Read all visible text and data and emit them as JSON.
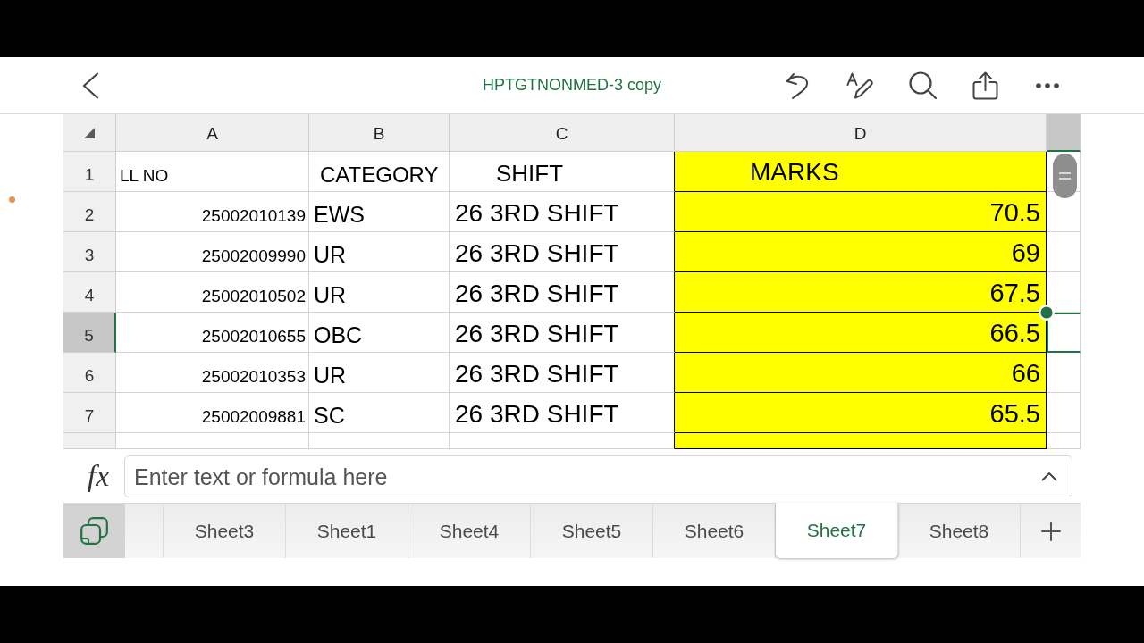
{
  "top_bar": {
    "title": "HPTGTNONMED-3 copy"
  },
  "sheet": {
    "columns": [
      {
        "label": "A",
        "selected": false,
        "highlighted": false
      },
      {
        "label": "B",
        "selected": false,
        "highlighted": false
      },
      {
        "label": "C",
        "selected": false,
        "highlighted": false
      },
      {
        "label": "D",
        "selected": false,
        "highlighted": true
      },
      {
        "selected": true,
        "highlighted": false
      }
    ],
    "rows": [
      {
        "kind": "header",
        "number": "1",
        "selected": false,
        "cells": [
          "LL NO",
          "CATEGORY",
          "SHIFT",
          "MARKS"
        ]
      },
      {
        "kind": "data",
        "number": "2",
        "selected": false,
        "cells": [
          "25002010139",
          "EWS",
          "26 3RD SHIFT",
          "70.5"
        ]
      },
      {
        "kind": "data",
        "number": "3",
        "selected": false,
        "cells": [
          "25002009990",
          "UR",
          "26 3RD SHIFT",
          "69"
        ]
      },
      {
        "kind": "data",
        "number": "4",
        "selected": false,
        "cells": [
          "25002010502",
          "UR",
          "26 3RD SHIFT",
          "67.5"
        ]
      },
      {
        "kind": "data",
        "number": "5",
        "selected": true,
        "cells": [
          "25002010655",
          "OBC",
          "26 3RD SHIFT",
          "66.5"
        ]
      },
      {
        "kind": "data",
        "number": "6",
        "selected": false,
        "cells": [
          "25002010353",
          "UR",
          "26 3RD SHIFT",
          "66"
        ]
      },
      {
        "kind": "data",
        "number": "7",
        "selected": false,
        "cells": [
          "25002009881",
          "SC",
          "26 3RD SHIFT",
          "65.5"
        ]
      }
    ]
  },
  "formula_bar": {
    "function_label": "fx",
    "placeholder": "Enter text or formula here"
  },
  "sheet_tabs": [
    {
      "label": "Sheet3",
      "selected": false
    },
    {
      "label": "Sheet1",
      "selected": false
    },
    {
      "label": "Sheet4",
      "selected": false
    },
    {
      "label": "Sheet5",
      "selected": false
    },
    {
      "label": "Sheet6",
      "selected": false
    },
    {
      "label": "Sheet7",
      "selected": true
    },
    {
      "label": "Sheet8",
      "selected": false
    }
  ]
}
